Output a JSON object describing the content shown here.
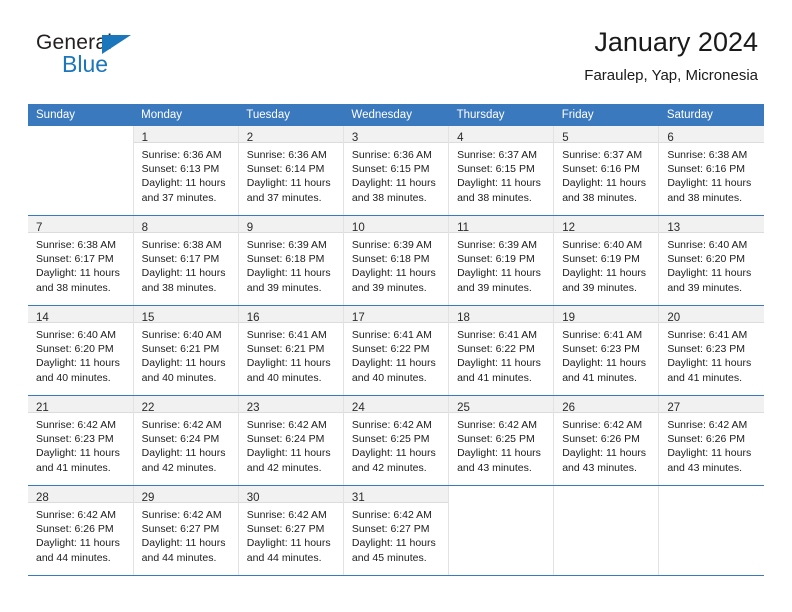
{
  "brand": {
    "name_part1": "General",
    "name_part2": "Blue"
  },
  "header": {
    "title": "January 2024",
    "subtitle": "Faraulep, Yap, Micronesia"
  },
  "colors": {
    "header_blue": "#3b79bf",
    "brand_blue": "#1b76bc",
    "daynum_band": "#f1f1f1",
    "text": "#1c1c1c"
  },
  "weekday_headers": [
    "Sunday",
    "Monday",
    "Tuesday",
    "Wednesday",
    "Thursday",
    "Friday",
    "Saturday"
  ],
  "weeks": [
    [
      {
        "day": "",
        "sunrise": "",
        "sunset": "",
        "daylight_line1": "",
        "daylight_line2": ""
      },
      {
        "day": "1",
        "sunrise": "Sunrise: 6:36 AM",
        "sunset": "Sunset: 6:13 PM",
        "daylight_line1": "Daylight: 11 hours",
        "daylight_line2": "and 37 minutes."
      },
      {
        "day": "2",
        "sunrise": "Sunrise: 6:36 AM",
        "sunset": "Sunset: 6:14 PM",
        "daylight_line1": "Daylight: 11 hours",
        "daylight_line2": "and 37 minutes."
      },
      {
        "day": "3",
        "sunrise": "Sunrise: 6:36 AM",
        "sunset": "Sunset: 6:15 PM",
        "daylight_line1": "Daylight: 11 hours",
        "daylight_line2": "and 38 minutes."
      },
      {
        "day": "4",
        "sunrise": "Sunrise: 6:37 AM",
        "sunset": "Sunset: 6:15 PM",
        "daylight_line1": "Daylight: 11 hours",
        "daylight_line2": "and 38 minutes."
      },
      {
        "day": "5",
        "sunrise": "Sunrise: 6:37 AM",
        "sunset": "Sunset: 6:16 PM",
        "daylight_line1": "Daylight: 11 hours",
        "daylight_line2": "and 38 minutes."
      },
      {
        "day": "6",
        "sunrise": "Sunrise: 6:38 AM",
        "sunset": "Sunset: 6:16 PM",
        "daylight_line1": "Daylight: 11 hours",
        "daylight_line2": "and 38 minutes."
      }
    ],
    [
      {
        "day": "7",
        "sunrise": "Sunrise: 6:38 AM",
        "sunset": "Sunset: 6:17 PM",
        "daylight_line1": "Daylight: 11 hours",
        "daylight_line2": "and 38 minutes."
      },
      {
        "day": "8",
        "sunrise": "Sunrise: 6:38 AM",
        "sunset": "Sunset: 6:17 PM",
        "daylight_line1": "Daylight: 11 hours",
        "daylight_line2": "and 38 minutes."
      },
      {
        "day": "9",
        "sunrise": "Sunrise: 6:39 AM",
        "sunset": "Sunset: 6:18 PM",
        "daylight_line1": "Daylight: 11 hours",
        "daylight_line2": "and 39 minutes."
      },
      {
        "day": "10",
        "sunrise": "Sunrise: 6:39 AM",
        "sunset": "Sunset: 6:18 PM",
        "daylight_line1": "Daylight: 11 hours",
        "daylight_line2": "and 39 minutes."
      },
      {
        "day": "11",
        "sunrise": "Sunrise: 6:39 AM",
        "sunset": "Sunset: 6:19 PM",
        "daylight_line1": "Daylight: 11 hours",
        "daylight_line2": "and 39 minutes."
      },
      {
        "day": "12",
        "sunrise": "Sunrise: 6:40 AM",
        "sunset": "Sunset: 6:19 PM",
        "daylight_line1": "Daylight: 11 hours",
        "daylight_line2": "and 39 minutes."
      },
      {
        "day": "13",
        "sunrise": "Sunrise: 6:40 AM",
        "sunset": "Sunset: 6:20 PM",
        "daylight_line1": "Daylight: 11 hours",
        "daylight_line2": "and 39 minutes."
      }
    ],
    [
      {
        "day": "14",
        "sunrise": "Sunrise: 6:40 AM",
        "sunset": "Sunset: 6:20 PM",
        "daylight_line1": "Daylight: 11 hours",
        "daylight_line2": "and 40 minutes."
      },
      {
        "day": "15",
        "sunrise": "Sunrise: 6:40 AM",
        "sunset": "Sunset: 6:21 PM",
        "daylight_line1": "Daylight: 11 hours",
        "daylight_line2": "and 40 minutes."
      },
      {
        "day": "16",
        "sunrise": "Sunrise: 6:41 AM",
        "sunset": "Sunset: 6:21 PM",
        "daylight_line1": "Daylight: 11 hours",
        "daylight_line2": "and 40 minutes."
      },
      {
        "day": "17",
        "sunrise": "Sunrise: 6:41 AM",
        "sunset": "Sunset: 6:22 PM",
        "daylight_line1": "Daylight: 11 hours",
        "daylight_line2": "and 40 minutes."
      },
      {
        "day": "18",
        "sunrise": "Sunrise: 6:41 AM",
        "sunset": "Sunset: 6:22 PM",
        "daylight_line1": "Daylight: 11 hours",
        "daylight_line2": "and 41 minutes."
      },
      {
        "day": "19",
        "sunrise": "Sunrise: 6:41 AM",
        "sunset": "Sunset: 6:23 PM",
        "daylight_line1": "Daylight: 11 hours",
        "daylight_line2": "and 41 minutes."
      },
      {
        "day": "20",
        "sunrise": "Sunrise: 6:41 AM",
        "sunset": "Sunset: 6:23 PM",
        "daylight_line1": "Daylight: 11 hours",
        "daylight_line2": "and 41 minutes."
      }
    ],
    [
      {
        "day": "21",
        "sunrise": "Sunrise: 6:42 AM",
        "sunset": "Sunset: 6:23 PM",
        "daylight_line1": "Daylight: 11 hours",
        "daylight_line2": "and 41 minutes."
      },
      {
        "day": "22",
        "sunrise": "Sunrise: 6:42 AM",
        "sunset": "Sunset: 6:24 PM",
        "daylight_line1": "Daylight: 11 hours",
        "daylight_line2": "and 42 minutes."
      },
      {
        "day": "23",
        "sunrise": "Sunrise: 6:42 AM",
        "sunset": "Sunset: 6:24 PM",
        "daylight_line1": "Daylight: 11 hours",
        "daylight_line2": "and 42 minutes."
      },
      {
        "day": "24",
        "sunrise": "Sunrise: 6:42 AM",
        "sunset": "Sunset: 6:25 PM",
        "daylight_line1": "Daylight: 11 hours",
        "daylight_line2": "and 42 minutes."
      },
      {
        "day": "25",
        "sunrise": "Sunrise: 6:42 AM",
        "sunset": "Sunset: 6:25 PM",
        "daylight_line1": "Daylight: 11 hours",
        "daylight_line2": "and 43 minutes."
      },
      {
        "day": "26",
        "sunrise": "Sunrise: 6:42 AM",
        "sunset": "Sunset: 6:26 PM",
        "daylight_line1": "Daylight: 11 hours",
        "daylight_line2": "and 43 minutes."
      },
      {
        "day": "27",
        "sunrise": "Sunrise: 6:42 AM",
        "sunset": "Sunset: 6:26 PM",
        "daylight_line1": "Daylight: 11 hours",
        "daylight_line2": "and 43 minutes."
      }
    ],
    [
      {
        "day": "28",
        "sunrise": "Sunrise: 6:42 AM",
        "sunset": "Sunset: 6:26 PM",
        "daylight_line1": "Daylight: 11 hours",
        "daylight_line2": "and 44 minutes."
      },
      {
        "day": "29",
        "sunrise": "Sunrise: 6:42 AM",
        "sunset": "Sunset: 6:27 PM",
        "daylight_line1": "Daylight: 11 hours",
        "daylight_line2": "and 44 minutes."
      },
      {
        "day": "30",
        "sunrise": "Sunrise: 6:42 AM",
        "sunset": "Sunset: 6:27 PM",
        "daylight_line1": "Daylight: 11 hours",
        "daylight_line2": "and 44 minutes."
      },
      {
        "day": "31",
        "sunrise": "Sunrise: 6:42 AM",
        "sunset": "Sunset: 6:27 PM",
        "daylight_line1": "Daylight: 11 hours",
        "daylight_line2": "and 45 minutes."
      },
      {
        "day": "",
        "sunrise": "",
        "sunset": "",
        "daylight_line1": "",
        "daylight_line2": ""
      },
      {
        "day": "",
        "sunrise": "",
        "sunset": "",
        "daylight_line1": "",
        "daylight_line2": ""
      },
      {
        "day": "",
        "sunrise": "",
        "sunset": "",
        "daylight_line1": "",
        "daylight_line2": ""
      }
    ]
  ]
}
